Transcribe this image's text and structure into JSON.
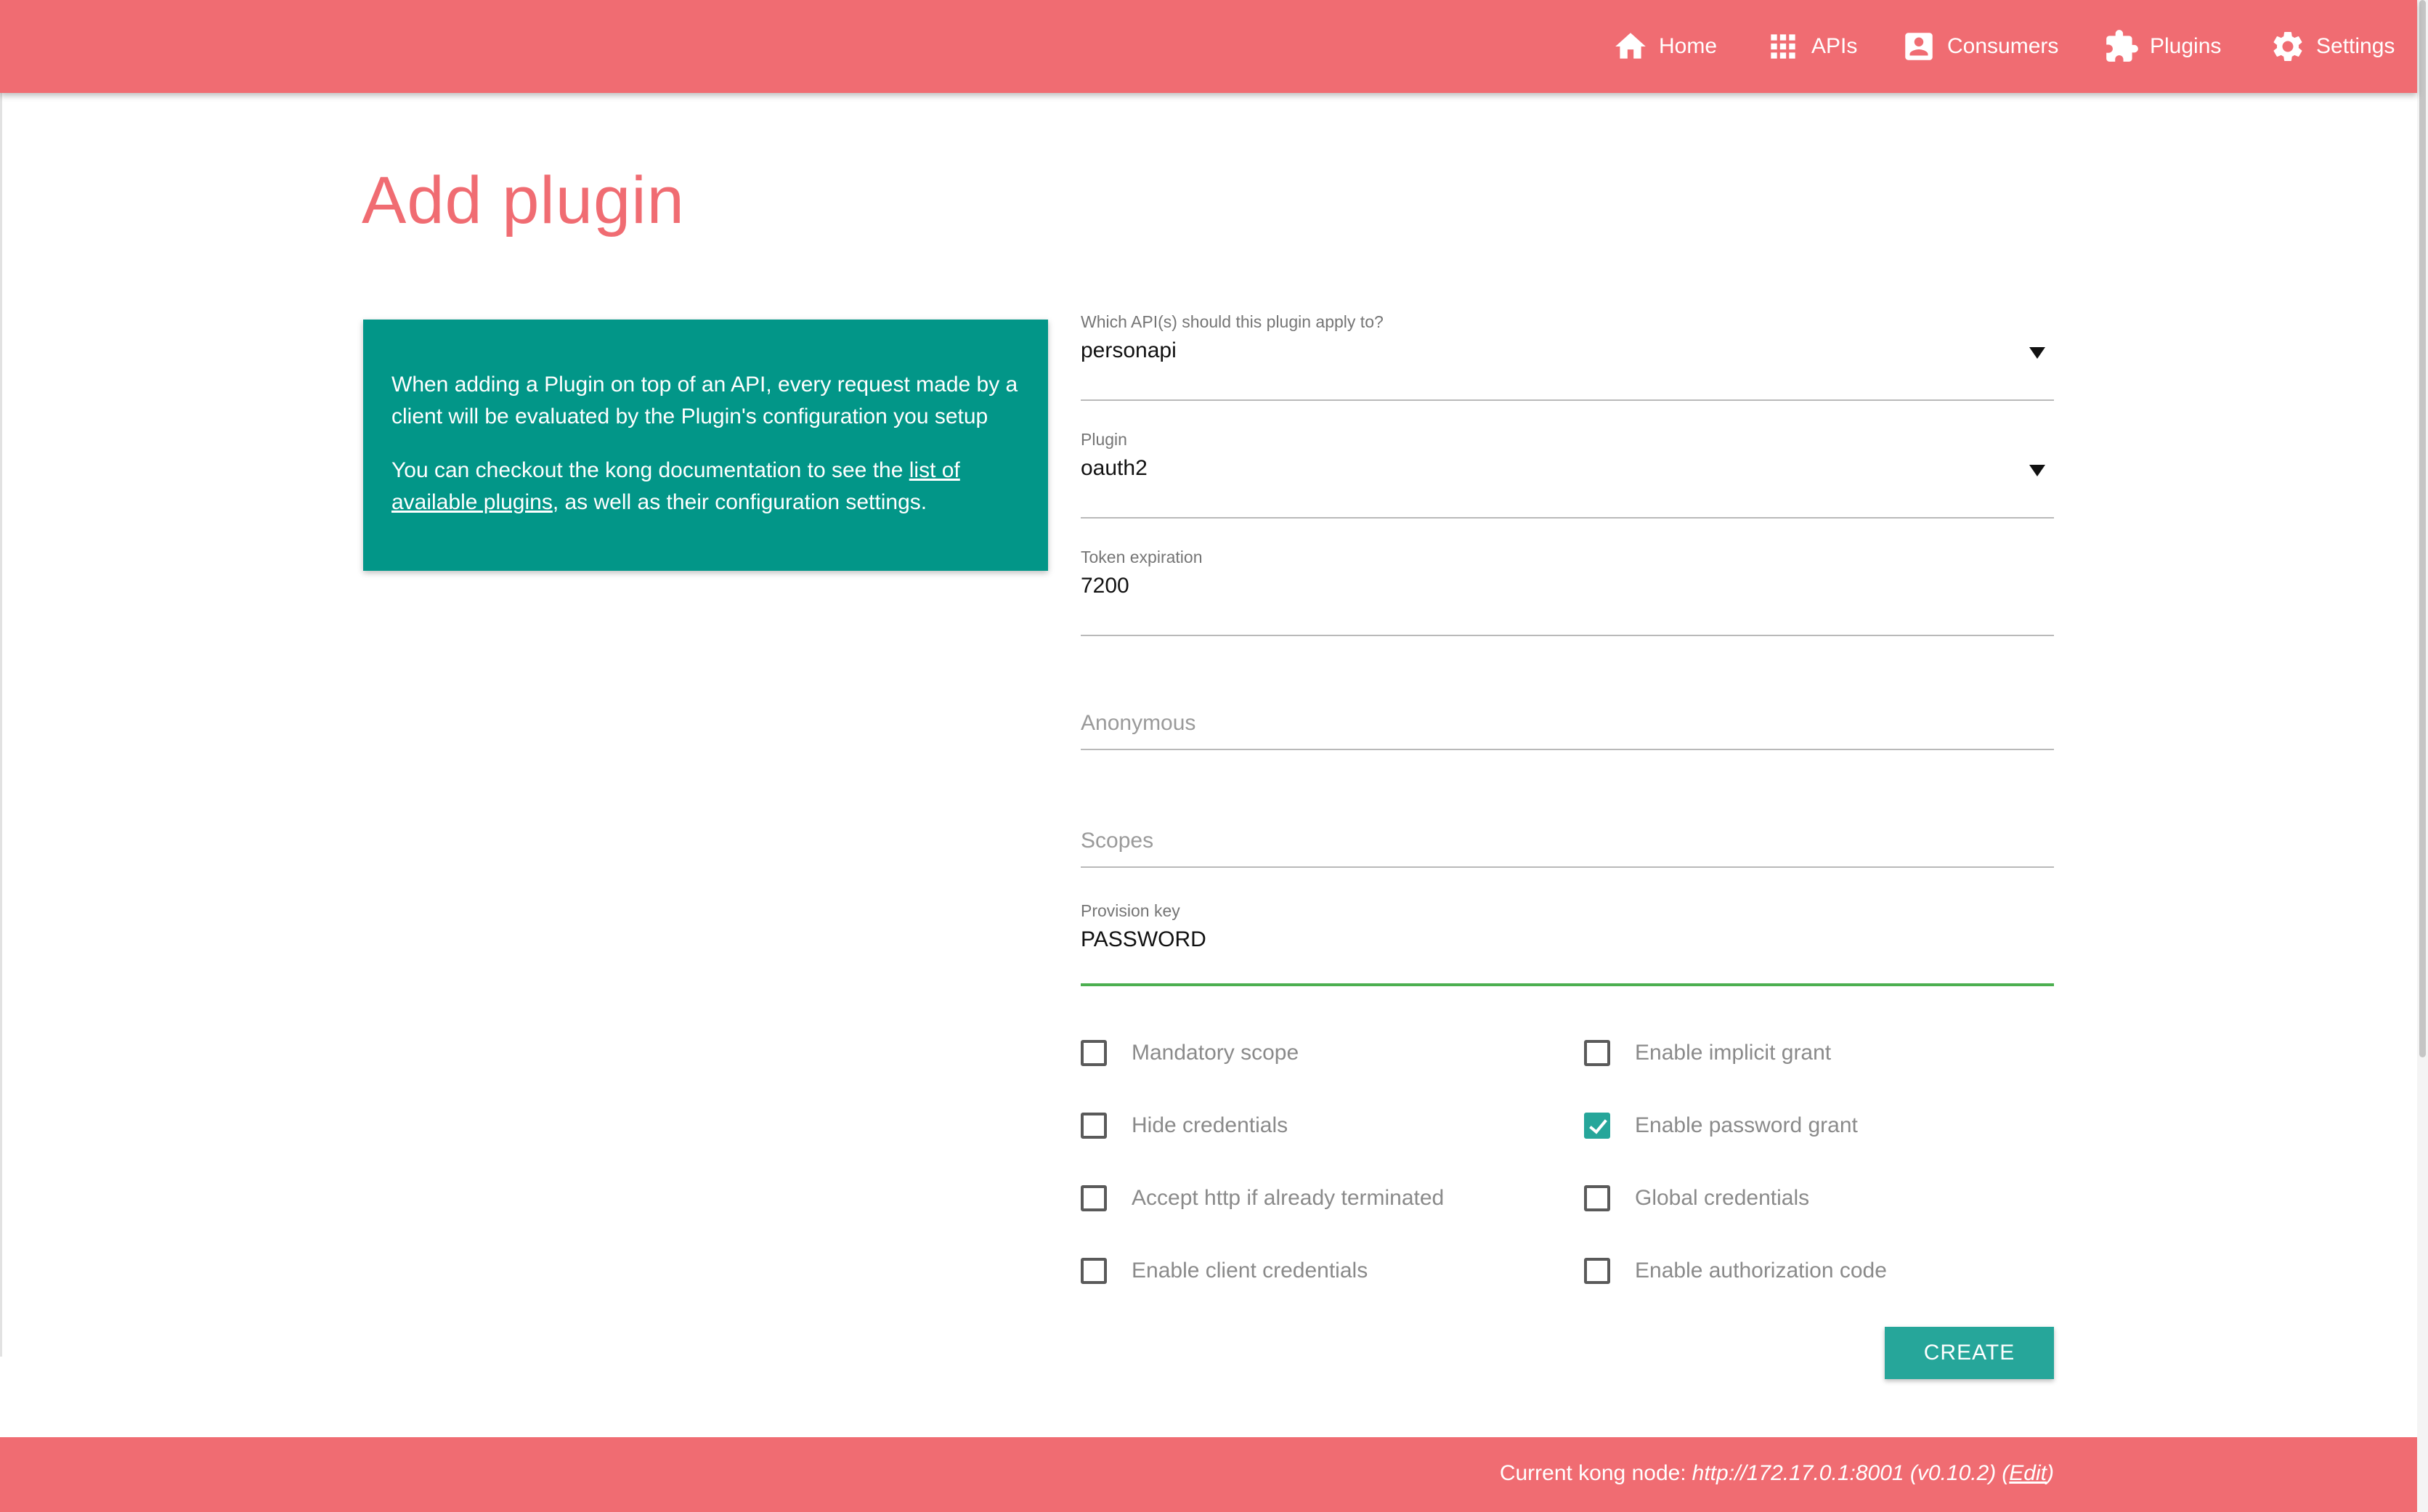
{
  "nav": {
    "items": [
      {
        "label": "Home",
        "icon": "home-icon"
      },
      {
        "label": "APIs",
        "icon": "grid-icon"
      },
      {
        "label": "Consumers",
        "icon": "account-box-icon"
      },
      {
        "label": "Plugins",
        "icon": "puzzle-icon"
      },
      {
        "label": "Settings",
        "icon": "gear-icon"
      }
    ]
  },
  "page": {
    "title": "Add plugin"
  },
  "info": {
    "paragraph1": "When adding a Plugin on top of an API, every request made by a client will be evaluated by the Plugin's configuration you setup",
    "paragraph2_before": "You can checkout the kong documentation to see the ",
    "paragraph2_link": "list of available plugins",
    "paragraph2_after": ", as well as their configuration settings."
  },
  "form": {
    "api": {
      "label": "Which API(s) should this plugin apply to?",
      "value": "personapi"
    },
    "plugin": {
      "label": "Plugin",
      "value": "oauth2"
    },
    "token_expiration": {
      "label": "Token expiration",
      "value": "7200"
    },
    "anonymous": {
      "placeholder": "Anonymous"
    },
    "scopes": {
      "placeholder": "Scopes"
    },
    "provision_key": {
      "label": "Provision key",
      "value": "PASSWORD"
    },
    "checkboxes": [
      {
        "label": "Mandatory scope",
        "checked": false
      },
      {
        "label": "Enable implicit grant",
        "checked": false
      },
      {
        "label": "Hide credentials",
        "checked": false
      },
      {
        "label": "Enable password grant",
        "checked": true
      },
      {
        "label": "Accept http if already terminated",
        "checked": false
      },
      {
        "label": "Global credentials",
        "checked": false
      },
      {
        "label": "Enable client credentials",
        "checked": false
      },
      {
        "label": "Enable authorization code",
        "checked": false
      }
    ],
    "create_label": "CREATE"
  },
  "footer": {
    "prefix": "Current kong node:",
    "node": "http://172.17.0.1:8001 (v0.10.2)",
    "open_paren": "(",
    "edit_label": "Edit",
    "close_paren": ")"
  },
  "colors": {
    "brand": "#f06c72",
    "accent": "#26a69a",
    "info_card": "#029688",
    "active_underline": "#4caf50"
  }
}
